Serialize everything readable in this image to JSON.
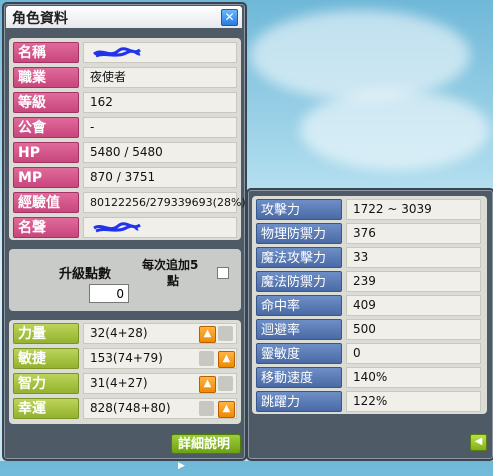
{
  "window": {
    "title": "角色資料",
    "close_icon": "close-icon"
  },
  "profile": [
    {
      "label": "名稱",
      "value": "",
      "redacted": true
    },
    {
      "label": "職業",
      "value": "夜使者"
    },
    {
      "label": "等級",
      "value": "162"
    },
    {
      "label": "公會",
      "value": "-"
    },
    {
      "label": "HP",
      "value": "5480 / 5480"
    },
    {
      "label": "MP",
      "value": "870 / 3751"
    },
    {
      "label": "經驗值",
      "value": "80122256/279339693(28%)"
    },
    {
      "label": "名聲",
      "value": "",
      "redacted": true
    }
  ],
  "ap": {
    "label": "升級點數",
    "value": "0",
    "auto_label_line1": "每次追加5",
    "auto_label_line2": "點",
    "auto_checked": false
  },
  "stats": [
    {
      "label": "力量",
      "value": "32(4+28)",
      "up_position": "left"
    },
    {
      "label": "敏捷",
      "value": "153(74+79)",
      "up_position": "right"
    },
    {
      "label": "智力",
      "value": "31(4+27)",
      "up_position": "left"
    },
    {
      "label": "幸運",
      "value": "828(748+80)",
      "up_position": "right"
    }
  ],
  "detail_button": {
    "label": "詳細說明"
  },
  "details": [
    {
      "label": "攻擊力",
      "value": "1722 ~ 3039"
    },
    {
      "label": "物理防禦力",
      "value": "376"
    },
    {
      "label": "魔法攻擊力",
      "value": "33"
    },
    {
      "label": "魔法防禦力",
      "value": "239"
    },
    {
      "label": "命中率",
      "value": "409"
    },
    {
      "label": "迴避率",
      "value": "500"
    },
    {
      "label": "靈敏度",
      "value": "0"
    },
    {
      "label": "移動速度",
      "value": "140%"
    },
    {
      "label": "跳躍力",
      "value": "122%"
    }
  ],
  "colors": {
    "profile_label": "#c8467d",
    "stat_label": "#93b22e",
    "detail_label": "#4a6aa6",
    "up_button": "#f08a00",
    "window_frame": "#4e5a66"
  }
}
